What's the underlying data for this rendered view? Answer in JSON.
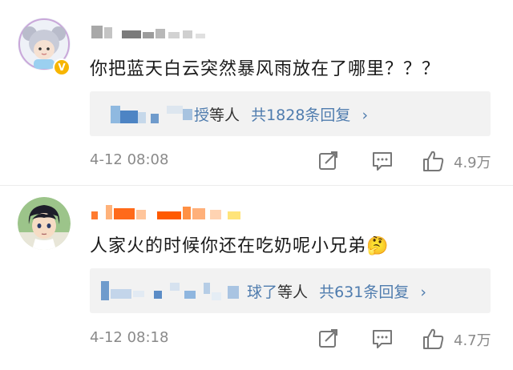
{
  "comments": [
    {
      "text": "你把蓝天白云突然暴风雨放在了哪里？？？",
      "reply_preview": {
        "name_tail": "授",
        "suffix": "等人",
        "count": "共1828条回复",
        "chevron": "›"
      },
      "time": "4-12 08:08",
      "likes": "4.9万",
      "verified_badge": "V"
    },
    {
      "text": "人家火的时候你还在吃奶呢小兄弟",
      "emoji": "🤔",
      "reply_preview": {
        "name_tail": "球了",
        "suffix": "等人",
        "count": "共631条回复",
        "chevron": "›"
      },
      "time": "4-12 08:18",
      "likes": "4.7万"
    }
  ],
  "colors": {
    "reply_link": "#4f7cae",
    "meta_gray": "#8a8a8a",
    "reply_bg": "#f2f2f2",
    "badge": "#f7b500"
  },
  "icons": [
    "share-icon",
    "comment-icon",
    "like-icon",
    "chevron-right-icon",
    "verified-badge-icon"
  ]
}
